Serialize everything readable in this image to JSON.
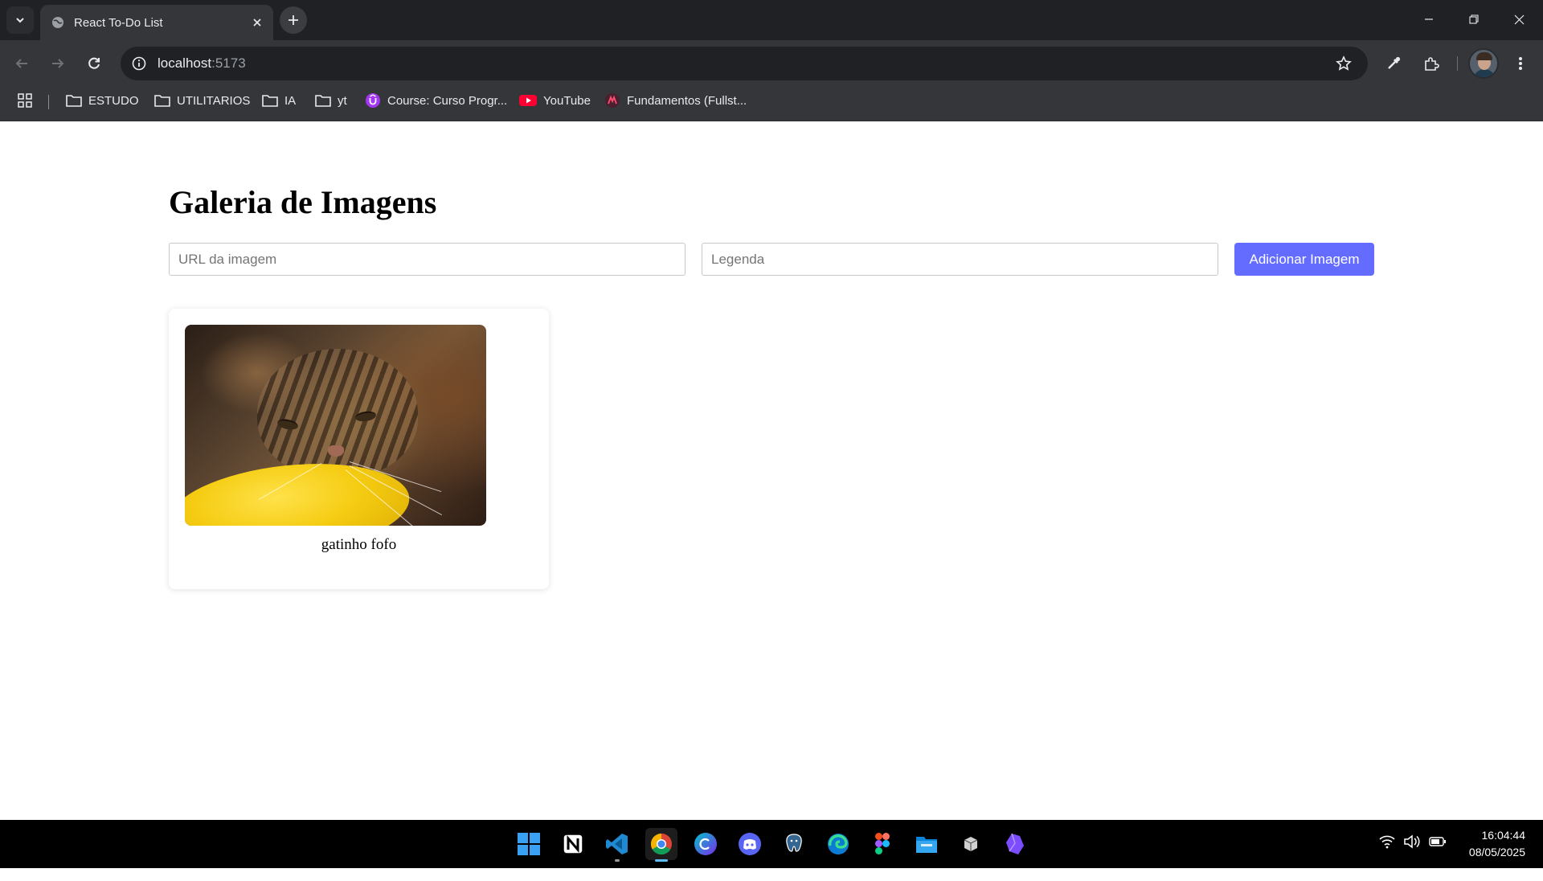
{
  "browser": {
    "tab_title": "React To-Do List",
    "url_host": "localhost",
    "url_port": ":5173",
    "bookmarks": [
      {
        "label": "ESTUDO",
        "icon": "folder-icon"
      },
      {
        "label": "UTILITARIOS",
        "icon": "folder-icon"
      },
      {
        "label": "IA",
        "icon": "folder-icon"
      },
      {
        "label": "yt",
        "icon": "folder-icon"
      },
      {
        "label": "Course: Curso Progr...",
        "icon": "udemy-icon"
      },
      {
        "label": "YouTube",
        "icon": "youtube-icon"
      },
      {
        "label": "Fundamentos (Fullst...",
        "icon": "rocketseat-icon"
      }
    ]
  },
  "page": {
    "title": "Galeria de Imagens",
    "url_input": {
      "placeholder": "URL da imagem",
      "value": ""
    },
    "caption_input": {
      "placeholder": "Legenda",
      "value": ""
    },
    "add_button": "Adicionar Imagem",
    "images": [
      {
        "caption": "gatinho fofo",
        "alt": "gatinho fofo"
      }
    ]
  },
  "taskbar": {
    "apps": [
      "windows-start-icon",
      "notion-icon",
      "vscode-icon",
      "chrome-icon",
      "canva-icon",
      "discord-icon",
      "postgresql-icon",
      "edge-icon",
      "figma-icon",
      "file-explorer-icon",
      "package-icon",
      "obsidian-icon"
    ],
    "time": "16:04:44",
    "date": "08/05/2025"
  },
  "colors": {
    "accent_button": "#646cff",
    "chrome_dark": "#202124",
    "chrome_mid": "#35363a"
  }
}
